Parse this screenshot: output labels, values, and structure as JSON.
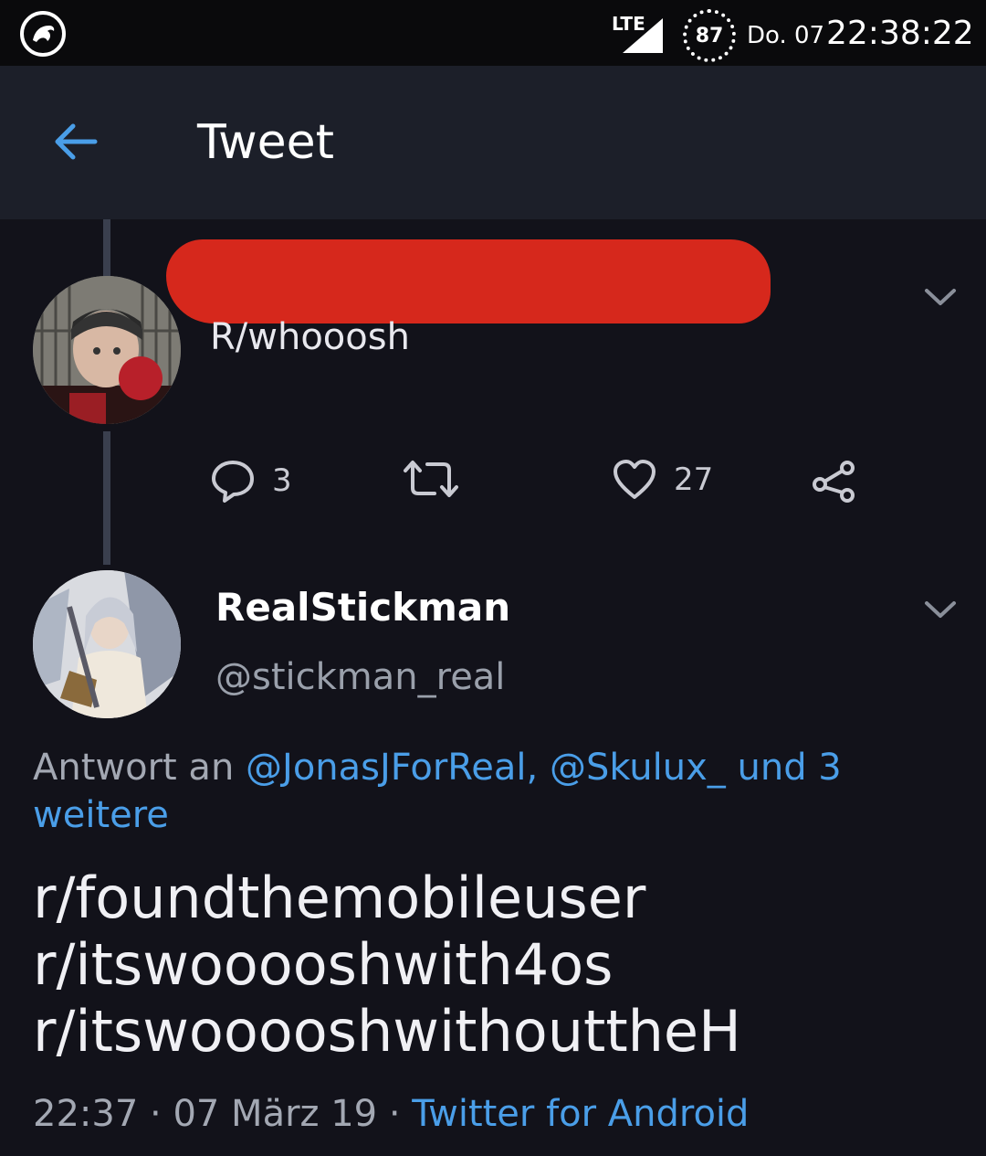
{
  "statusbar": {
    "network": "LTE",
    "battery": "87",
    "date": "Do. 07",
    "time": "22:38:22"
  },
  "appbar": {
    "title": "Tweet"
  },
  "tweet1": {
    "text": "R/whooosh",
    "reply_count": "3",
    "like_count": "27"
  },
  "tweet2": {
    "name": "RealStickman",
    "handle": "@stickman_real",
    "reply_prefix": "Antwort an ",
    "mention1": "@JonasJForReal,",
    "mention2": "@Skulux_",
    "mention_more": "und 3 weitere",
    "lines": [
      "r/foundthemobileuser",
      "r/itswooooshwith4os",
      "r/itswooooshwithouttheH"
    ],
    "time": "22:37",
    "date": "07 März 19",
    "source": "Twitter for Android"
  },
  "colors": {
    "background": "#12121a",
    "appbar": "#1c1f29",
    "accent": "#4a9ee8",
    "redaction": "#d6281c"
  },
  "icons": [
    "logo-icon",
    "signal-icon",
    "back-arrow-icon",
    "chevron-down-icon",
    "reply-icon",
    "retweet-icon",
    "like-icon",
    "share-icon"
  ]
}
